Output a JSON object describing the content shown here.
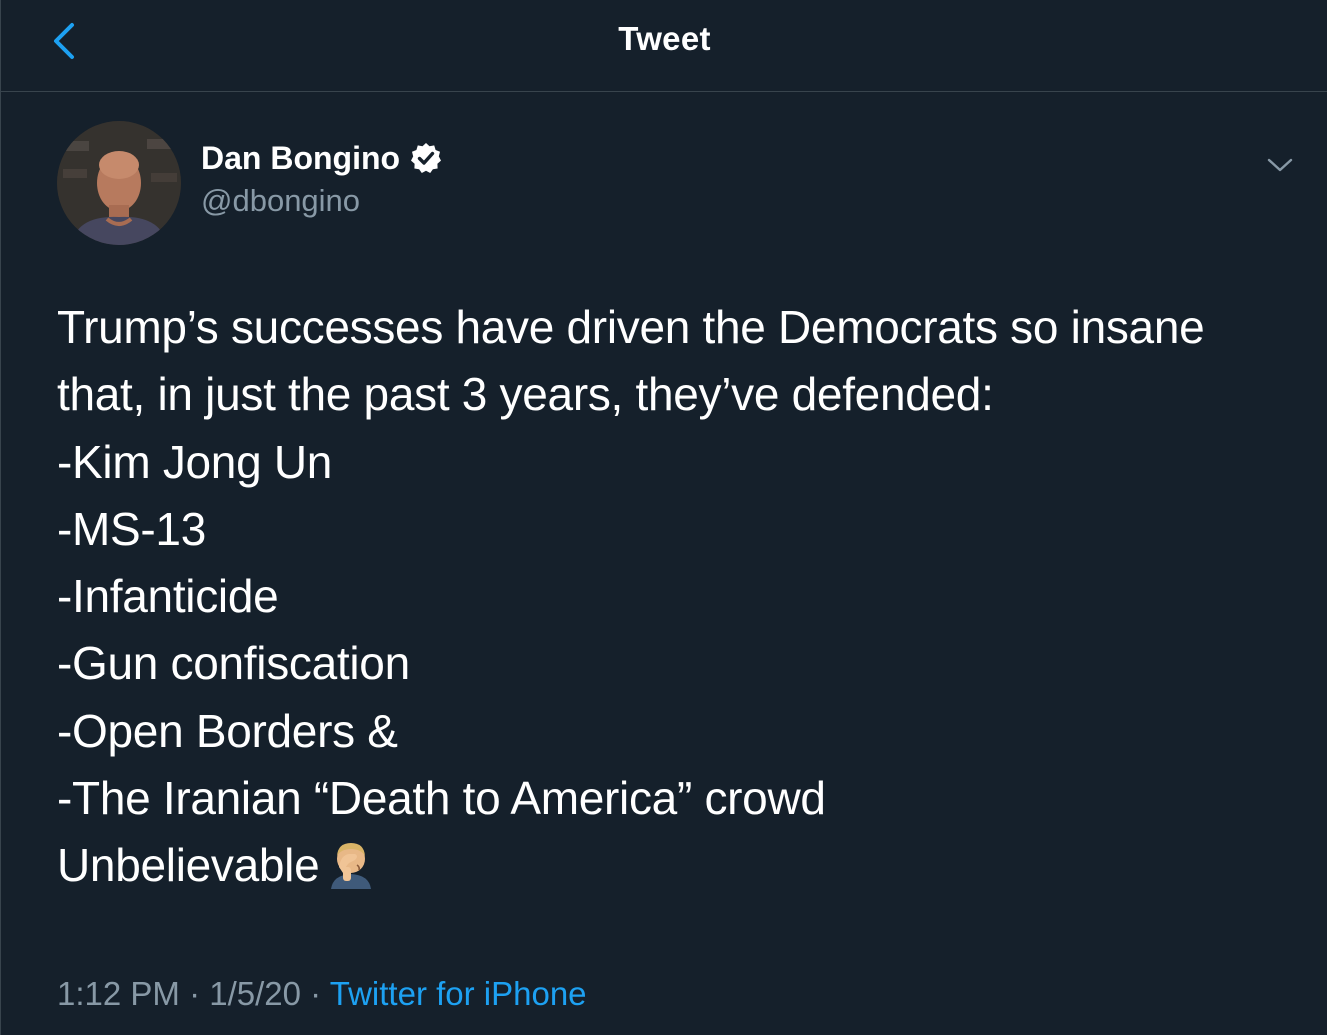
{
  "header": {
    "title": "Tweet",
    "back_icon": "chevron-left-icon"
  },
  "author": {
    "display_name": "Dan Bongino",
    "handle": "@dbongino",
    "verified": true
  },
  "tweet": {
    "lines": [
      "Trump’s successes have driven the Democrats so insane",
      "that, in just the past 3 years, they’ve defended:",
      "-Kim Jong Un",
      "-MS-13",
      "-Infanticide",
      "-Gun confiscation",
      "-Open Borders &",
      "-The Iranian “Death to America” crowd",
      "Unbelievable"
    ],
    "emoji": "man-facepalming-emoji"
  },
  "meta": {
    "time": "1:12 PM",
    "separator": "·",
    "date": "1/5/20",
    "source": "Twitter for iPhone"
  },
  "colors": {
    "background": "#15202b",
    "divider": "#38444d",
    "accent": "#1da1f2",
    "secondary_text": "#8899a6"
  }
}
